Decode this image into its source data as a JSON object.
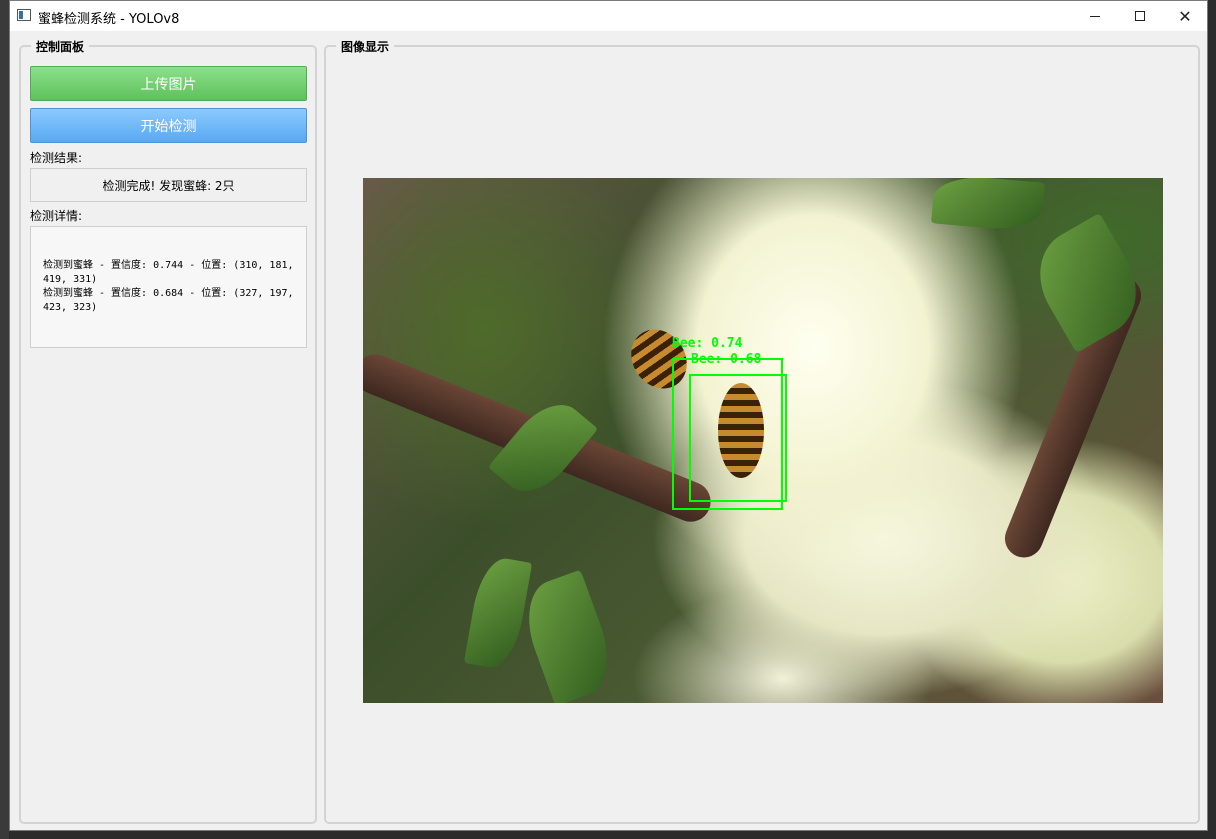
{
  "window": {
    "title": "蜜蜂检测系统 - YOLOv8"
  },
  "control_panel": {
    "title": "控制面板",
    "upload_button": "上传图片",
    "detect_button": "开始检测",
    "result_label": "检测结果:",
    "result_text": "检测完成! 发现蜜蜂: 2只",
    "details_label": "检测详情:",
    "details": [
      "检测到蜜蜂 - 置信度: 0.744 - 位置: (310, 181, 419, 331)",
      "检测到蜜蜂 - 置信度: 0.684 - 位置: (327, 197, 423, 323)"
    ]
  },
  "image_panel": {
    "title": "图像显示",
    "detections": [
      {
        "label": "Bee: 0.74"
      },
      {
        "label": "Bee: 0.68"
      }
    ]
  },
  "colors": {
    "upload": "#6fd06c",
    "detect": "#6fb8ff",
    "detection_box": "#00ff00"
  }
}
